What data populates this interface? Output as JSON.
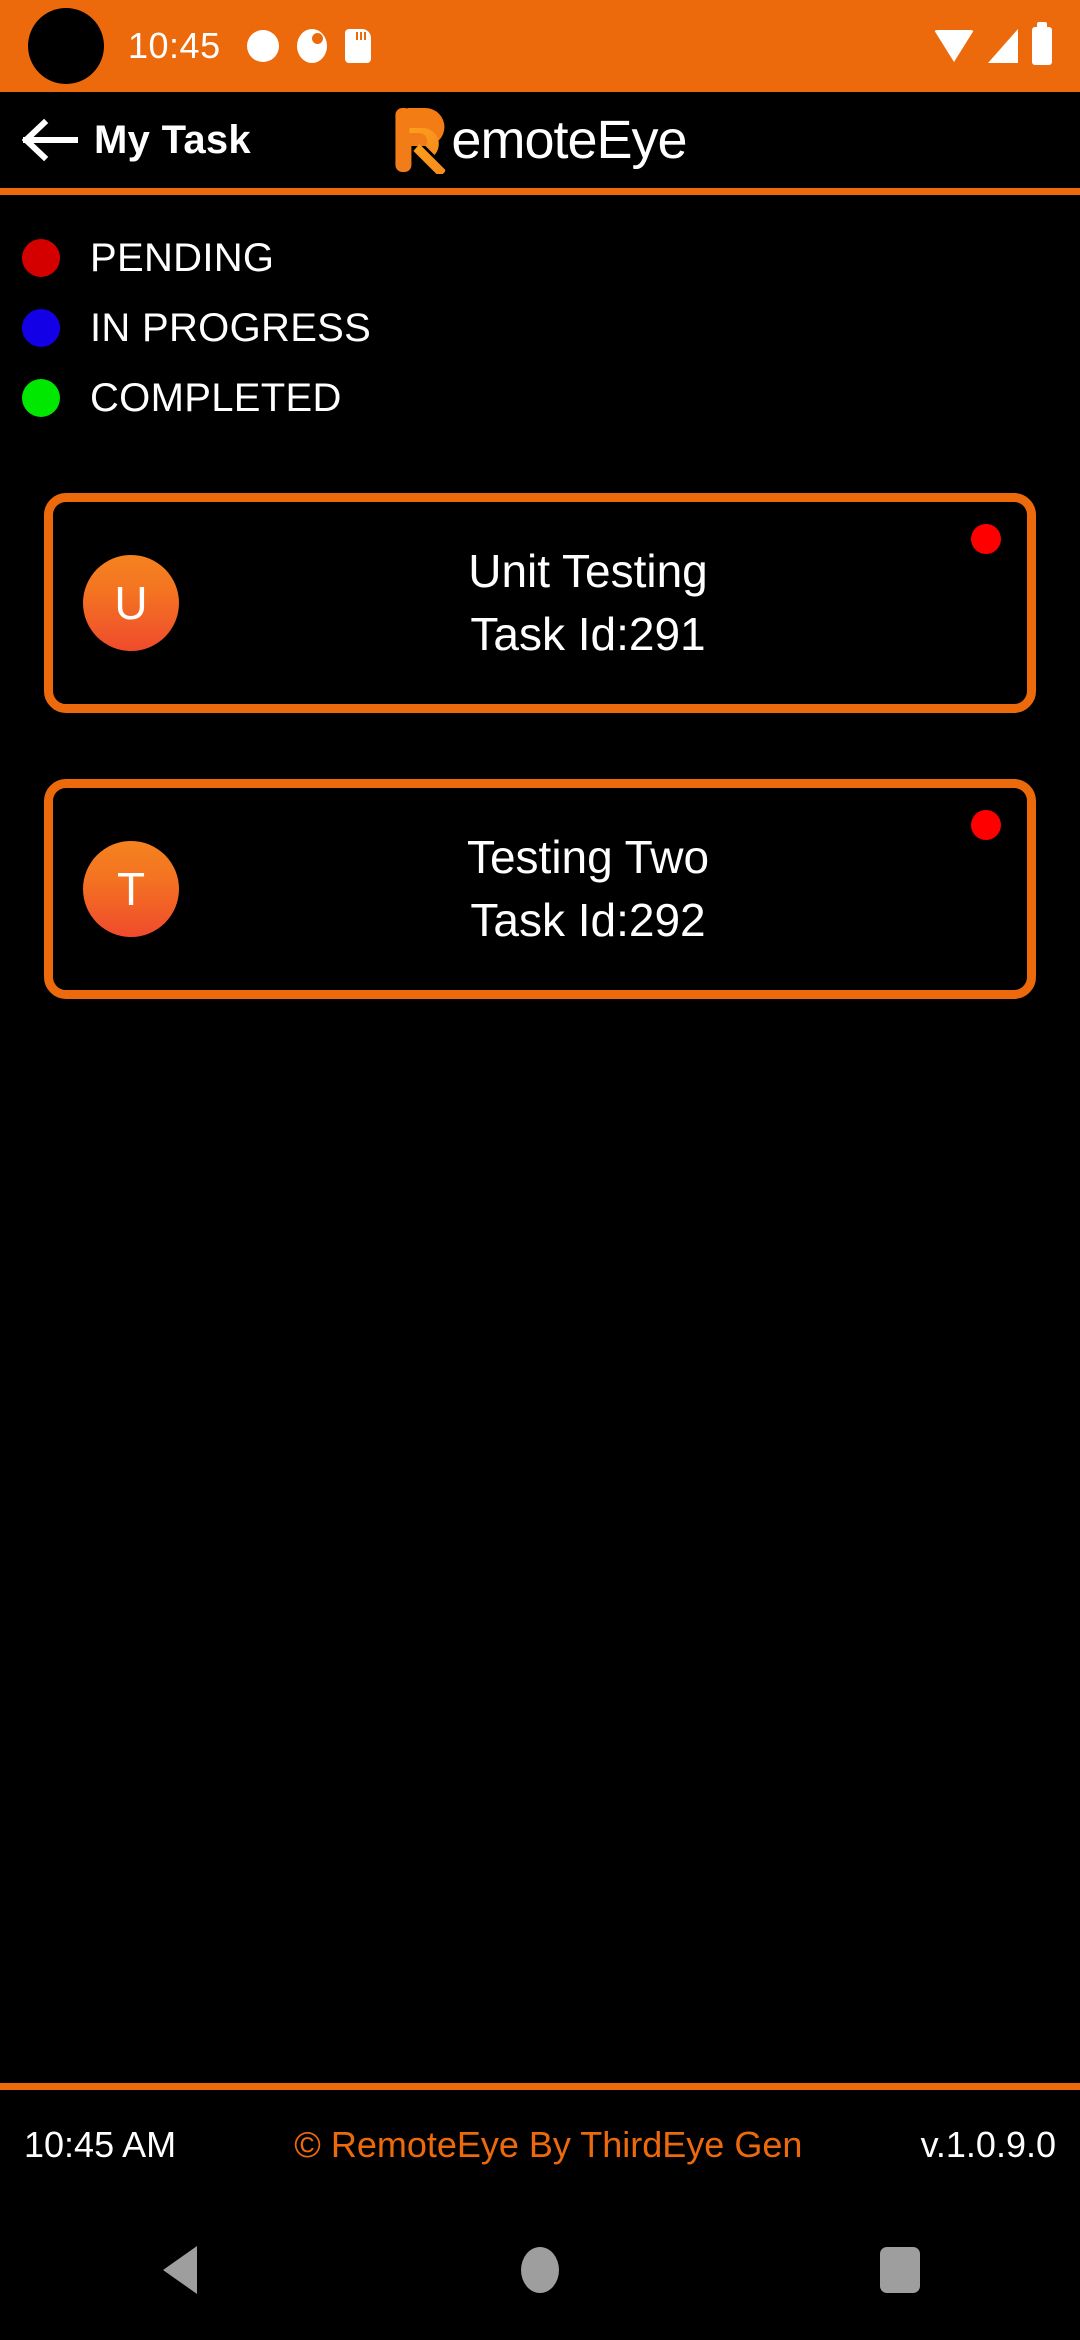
{
  "status_bar": {
    "time": "10:45",
    "background": "#ED6A0C",
    "left_icons": [
      "circle-icon",
      "eye-icon",
      "sd-card-icon"
    ],
    "right_icons": [
      "wifi-icon",
      "cellular-signal-icon",
      "battery-icon"
    ]
  },
  "header": {
    "back_label": "My Task",
    "brand_initial": "R",
    "brand_name": "emoteEye",
    "brand_full": "RemoteEye",
    "accent_color": "#ED6A0C"
  },
  "legend": {
    "items": [
      {
        "label": "PENDING",
        "color": "#D40000"
      },
      {
        "label": "IN PROGRESS",
        "color": "#1400E6"
      },
      {
        "label": "COMPLETED",
        "color": "#00E800"
      }
    ]
  },
  "tasks": [
    {
      "avatar_letter": "U",
      "title": "Unit Testing",
      "task_id": "Task Id:291",
      "status": "PENDING",
      "status_color": "#FF0000"
    },
    {
      "avatar_letter": "T",
      "title": "Testing Two",
      "task_id": "Task Id:292",
      "status": "PENDING",
      "status_color": "#FF0000"
    }
  ],
  "footer": {
    "time": "10:45 AM",
    "copyright": "© RemoteEye By ThirdEye Gen",
    "version": "v.1.0.9.0"
  },
  "nav_bar": {
    "back": "back-triangle-icon",
    "home": "home-circle-icon",
    "recents": "recents-square-icon",
    "color": "#9E9E9E"
  }
}
